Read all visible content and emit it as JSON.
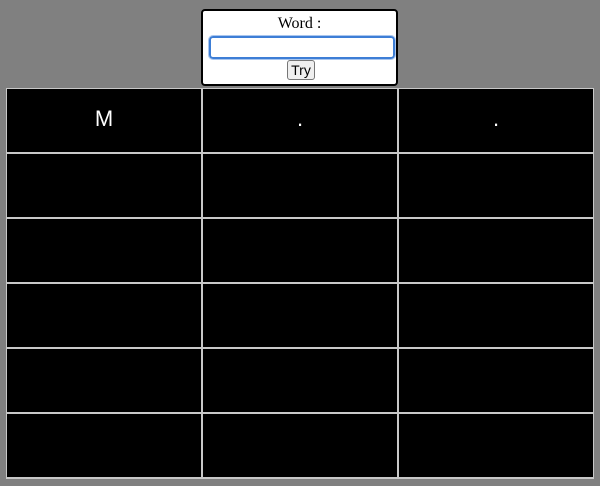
{
  "form": {
    "label": "Word :",
    "input_value": "",
    "input_placeholder": "",
    "button_label": "Try"
  },
  "grid": {
    "rows": [
      [
        "M",
        ".",
        "."
      ],
      [
        "",
        "",
        ""
      ],
      [
        "",
        "",
        ""
      ],
      [
        "",
        "",
        ""
      ],
      [
        "",
        "",
        ""
      ],
      [
        "",
        "",
        ""
      ]
    ]
  },
  "colors": {
    "background": "#808080",
    "cell": "#000000",
    "cell_text": "#ffffff",
    "grid_line": "#c8c8c8",
    "input_focus": "#3d7ed6"
  }
}
